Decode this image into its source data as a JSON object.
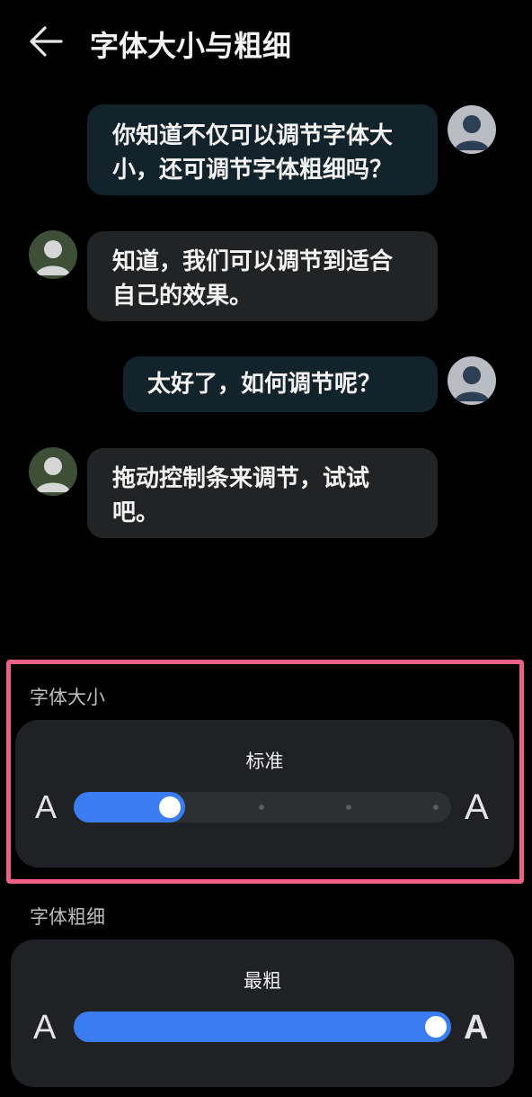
{
  "header": {
    "title": "字体大小与粗细",
    "back_icon": "arrow-left-icon"
  },
  "chat": {
    "messages": [
      {
        "side": "out",
        "text_lines": [
          "你知道不仅可以调节字体大",
          "小，还可调节字体粗细吗？"
        ]
      },
      {
        "side": "in",
        "text_lines": [
          "知道，我们可以调节到适合",
          "自己的效果。"
        ]
      },
      {
        "side": "out",
        "text_lines": [
          "太好了，如何调节呢？"
        ]
      },
      {
        "side": "in",
        "text_lines": [
          "拖动控制条来调节，试试",
          "吧。"
        ]
      }
    ],
    "avatar_icon": "person-avatar-icon"
  },
  "font_size": {
    "label": "字体大小",
    "value_label": "标准",
    "small_glyph": "A",
    "large_glyph": "A",
    "level": 2,
    "levels": 5
  },
  "font_weight": {
    "label": "字体粗细",
    "value_label": "最粗",
    "small_glyph": "A",
    "large_glyph": "A",
    "fraction": 1.0
  },
  "colors": {
    "accent": "#3a7cf2",
    "highlight_outline": "#ee6187",
    "outgoing_bubble": "#13232b",
    "incoming_bubble": "#222325"
  }
}
